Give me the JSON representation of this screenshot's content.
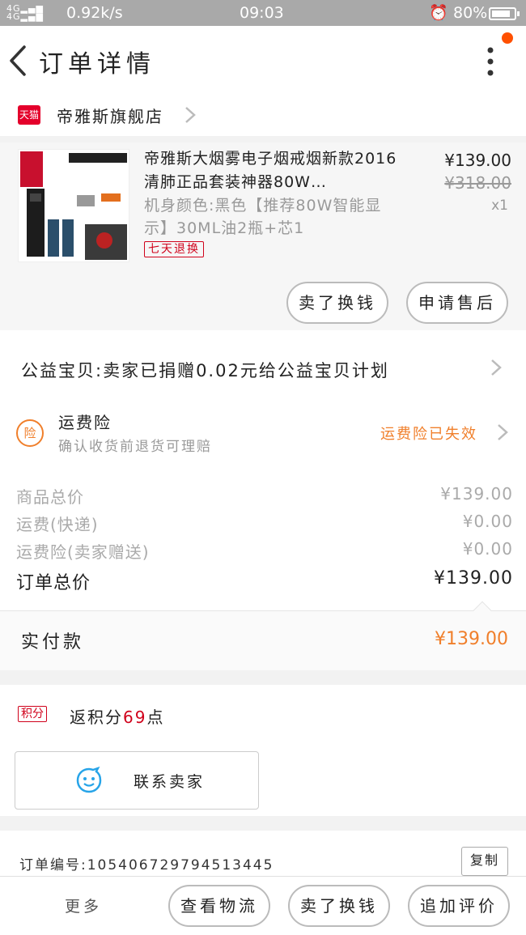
{
  "status_bar": {
    "signal_text": "4G 4G",
    "speed": "0.92k/s",
    "time": "09:03",
    "battery": "80%",
    "battery_level": 0.8
  },
  "header": {
    "title": "订单详情"
  },
  "store": {
    "badge": "天猫",
    "name": "帝雅斯旗舰店"
  },
  "product": {
    "title": "帝雅斯大烟雾电子烟戒烟新款2016清肺正品套装神器80W…",
    "sku": "机身颜色:黑色【推荐80W智能显示】30ML油2瓶+芯1",
    "badge": "七天退换",
    "price": "¥139.00",
    "original_price": "¥318.00",
    "quantity": "x1",
    "buttons": [
      "卖了换钱",
      "申请售后"
    ]
  },
  "charity": {
    "text": "公益宝贝:卖家已捐赠0.02元给公益宝贝计划"
  },
  "insurance": {
    "icon": "险",
    "name": "运费险",
    "desc": "确认收货前退货可理赔",
    "status": "运费险已失效"
  },
  "totals": {
    "rows": [
      {
        "label": "商品总价",
        "value": "¥139.00"
      },
      {
        "label": "运费(快递)",
        "value": "¥0.00"
      },
      {
        "label": "运费险(卖家赠送)",
        "value": "¥0.00"
      }
    ],
    "order_total_label": "订单总价",
    "order_total_value": "¥139.00"
  },
  "paid": {
    "label": "实付款",
    "value": "¥139.00"
  },
  "points": {
    "tag": "积分",
    "text_prefix": "返积分",
    "count": "69",
    "text_suffix": "点"
  },
  "contact": {
    "label": "联系卖家"
  },
  "order": {
    "number_text": "订单编号:1054067297945134​45",
    "copy_label": "复制"
  },
  "bottom_bar": {
    "more_label": "更多",
    "buttons": [
      "查看物流",
      "卖了换钱",
      "追加评价"
    ]
  },
  "colors": {
    "accent_orange": "#f07f2b",
    "tmall_red": "#e4002b",
    "badge_red": "#d0021b",
    "notification_dot": "#ff5000"
  }
}
